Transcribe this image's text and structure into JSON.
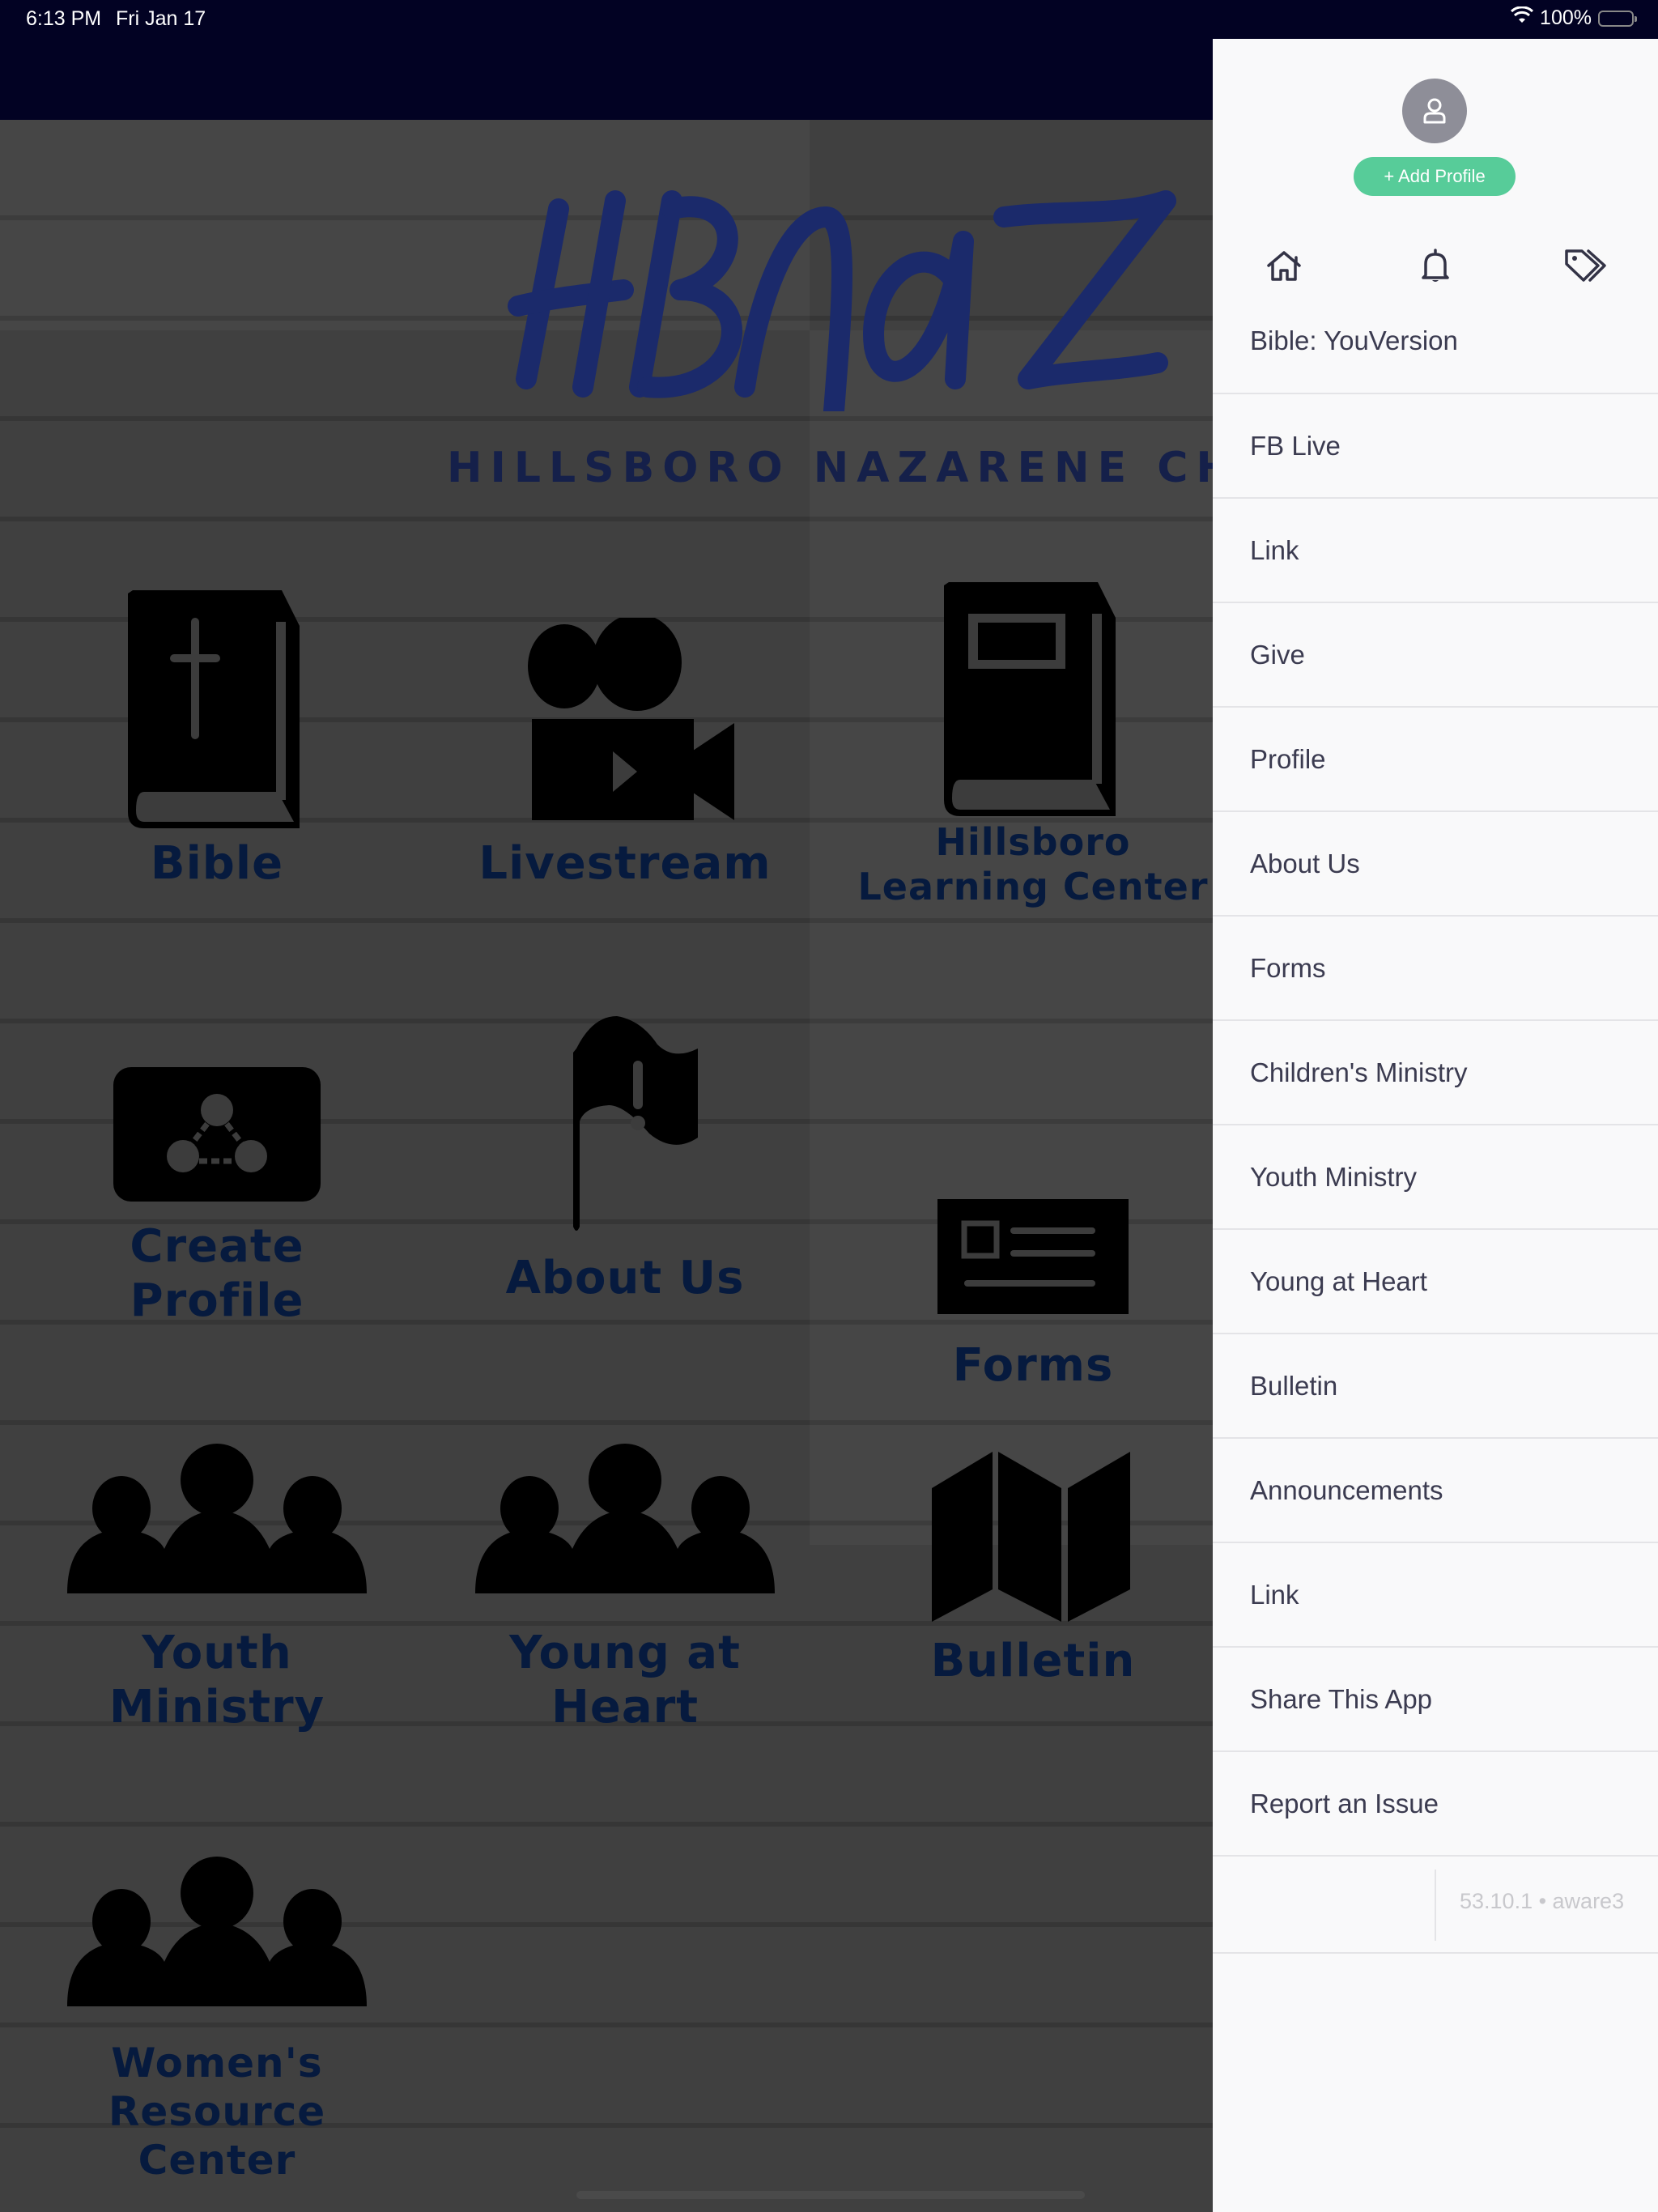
{
  "status_bar": {
    "time": "6:13 PM",
    "date": "Fri Jan 17",
    "battery": "100%",
    "wifi_icon": "wifi-icon",
    "battery_icon": "battery-icon"
  },
  "logo": {
    "script_text": "HBNAZ",
    "subtitle": "HILLSBORO NAZARENE CHURCH",
    "brand_color": "#1b2a6b"
  },
  "tiles": [
    {
      "label": "Bible",
      "icon": "bible-icon"
    },
    {
      "label": "Livestream",
      "icon": "video-camera-icon"
    },
    {
      "label": "Hillsboro Learning Center",
      "label_lines": [
        "Hillsboro",
        "Learning Center"
      ],
      "icon": "book-icon"
    },
    {
      "label": "Create Profile",
      "label_lines": [
        "Create",
        "Profile"
      ],
      "icon": "profile-network-icon"
    },
    {
      "label": "About Us",
      "icon": "flag-icon"
    },
    {
      "label": "Forms",
      "icon": "form-icon"
    },
    {
      "label": "Youth Ministry",
      "label_lines": [
        "Youth",
        "Ministry"
      ],
      "icon": "group-icon"
    },
    {
      "label": "Young at Heart",
      "label_lines": [
        "Young at",
        "Heart"
      ],
      "icon": "group-icon"
    },
    {
      "label": "Bulletin",
      "icon": "folded-map-icon"
    },
    {
      "label": "Women's Resource Center",
      "label_lines": [
        "Women's",
        "Resource Center"
      ],
      "icon": "group-icon"
    }
  ],
  "drawer": {
    "avatar_icon": "user-icon",
    "add_profile_label": "+ Add Profile",
    "accent_color": "#57cc99",
    "quick_icons": [
      "home-icon",
      "bell-icon",
      "tags-icon"
    ],
    "menu_items": [
      "Bible: YouVersion",
      "FB Live",
      "Link",
      "Give",
      "Profile",
      "About Us",
      "Forms",
      "Children's Ministry",
      "Youth Ministry",
      "Young at Heart",
      "Bulletin",
      "Announcements",
      "Link",
      "Share This App",
      "Report an Issue"
    ],
    "version": "53.10.1 • aware3"
  }
}
